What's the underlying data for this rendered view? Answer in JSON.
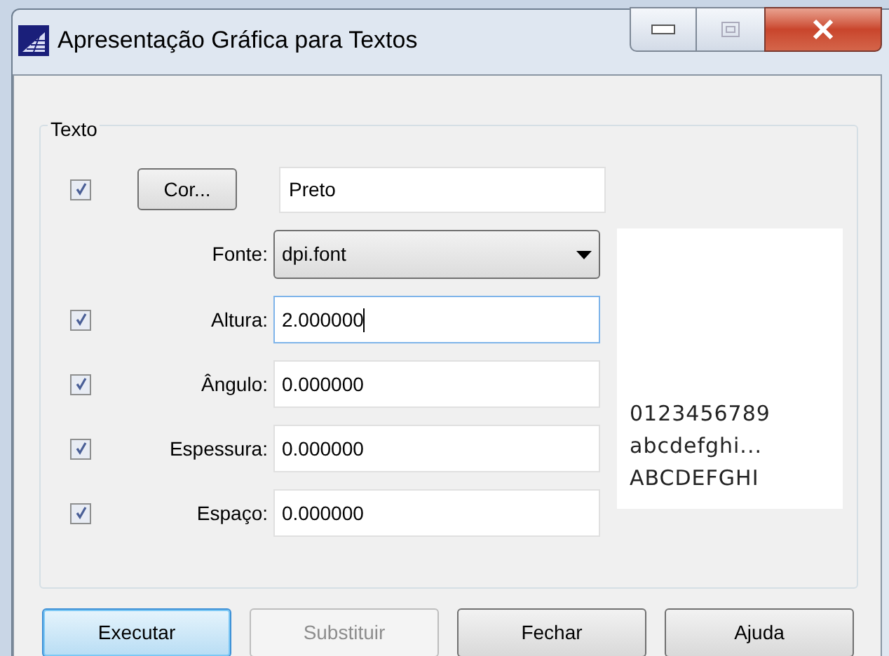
{
  "window": {
    "title": "Apresentação Gráfica para Textos"
  },
  "group": {
    "title": "Texto"
  },
  "color_row": {
    "checked": true,
    "button": "Cor...",
    "value": "Preto"
  },
  "font_row": {
    "label": "Fonte:",
    "value": "dpi.font"
  },
  "fields": [
    {
      "label": "Altura:",
      "value": "2.000000",
      "checked": true,
      "focused": true
    },
    {
      "label": "Ângulo:",
      "value": "0.000000",
      "checked": true,
      "focused": false
    },
    {
      "label": "Espessura:",
      "value": "0.000000",
      "checked": true,
      "focused": false
    },
    {
      "label": "Espaço:",
      "value": "0.000000",
      "checked": true,
      "focused": false
    }
  ],
  "preview": [
    "0123456789",
    "abcdefghi...",
    "ABCDEFGHI"
  ],
  "buttons": [
    {
      "label": "Executar",
      "disabled": false,
      "default": true
    },
    {
      "label": "Substituir",
      "disabled": true,
      "default": false
    },
    {
      "label": "Fechar",
      "disabled": false,
      "default": false
    },
    {
      "label": "Ajuda",
      "disabled": false,
      "default": false
    }
  ]
}
